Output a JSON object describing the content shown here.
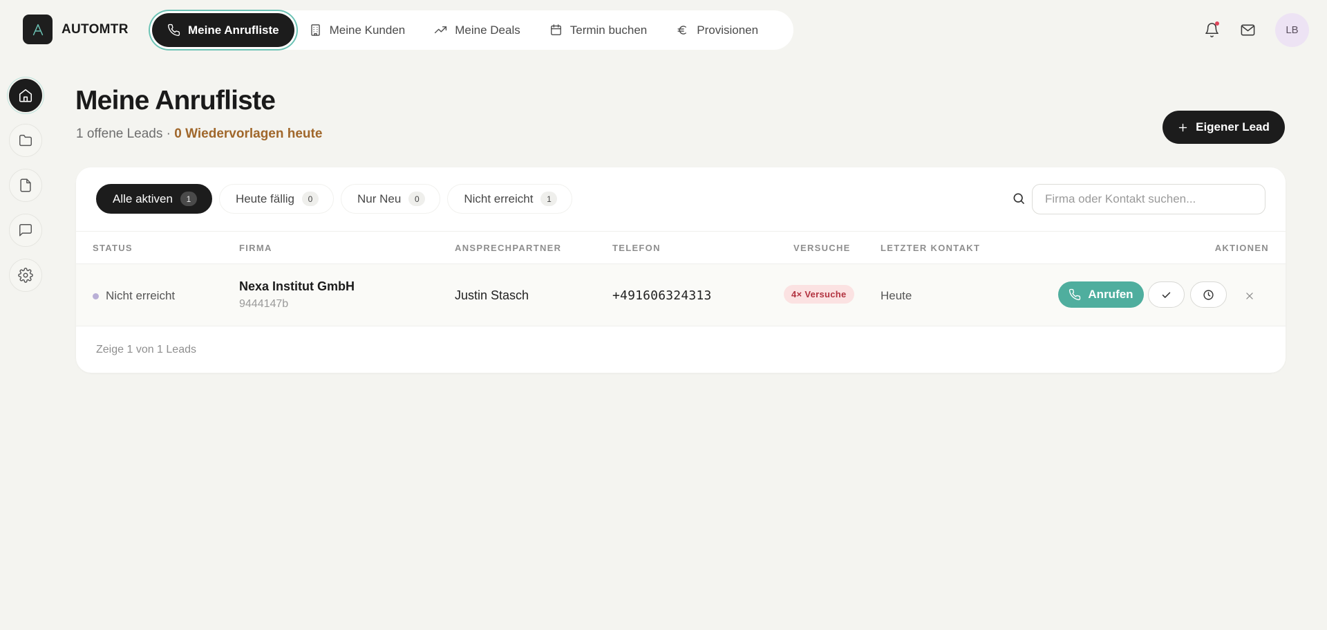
{
  "brand": {
    "name": "AUTOMTR",
    "logo_icon": "automtr-logo"
  },
  "topnav": {
    "items": [
      {
        "label": "Meine Anrufliste",
        "icon": "phone-icon",
        "active": true
      },
      {
        "label": "Meine Kunden",
        "icon": "building-icon",
        "active": false
      },
      {
        "label": "Meine Deals",
        "icon": "trending-up-icon",
        "active": false
      },
      {
        "label": "Termin buchen",
        "icon": "calendar-icon",
        "active": false
      },
      {
        "label": "Provisionen",
        "icon": "euro-icon",
        "active": false
      }
    ]
  },
  "topbar": {
    "notification_icon": "bell-icon",
    "notification_dot_color": "#e0455a",
    "mail_icon": "mail-icon",
    "avatar_initials": "LB"
  },
  "sidebar": {
    "items": [
      {
        "icon": "home-icon",
        "active": true
      },
      {
        "icon": "folder-icon",
        "active": false
      },
      {
        "icon": "document-icon",
        "active": false
      },
      {
        "icon": "chat-icon",
        "active": false
      },
      {
        "icon": "settings-icon",
        "active": false
      }
    ]
  },
  "header": {
    "title": "Meine Anrufliste",
    "subtitle_prefix": "1 offene Leads · ",
    "subtitle_highlight": "0 Wiedervorlagen heute",
    "action_label": "Eigener Lead"
  },
  "filters": [
    {
      "label": "Alle aktiven",
      "count": "1",
      "active": true
    },
    {
      "label": "Heute fällig",
      "count": "0",
      "active": false
    },
    {
      "label": "Nur Neu",
      "count": "0",
      "active": false
    },
    {
      "label": "Nicht erreicht",
      "count": "1",
      "active": false
    }
  ],
  "search": {
    "placeholder": "Firma oder Kontakt suchen...",
    "value": ""
  },
  "table": {
    "columns": [
      "STATUS",
      "FIRMA",
      "ANSPRECHPARTNER",
      "TELEFON",
      "VERSUCHE",
      "LETZTER KONTAKT",
      "AKTIONEN"
    ],
    "rows": [
      {
        "status": "Nicht erreicht",
        "company": "Nexa Institut GmbH",
        "company_id": "9444147b",
        "contact": "Justin Stasch",
        "phone": "+491606324313",
        "attempts": "4× Versuche",
        "last_contact": "Heute",
        "call_label": "Anrufen"
      }
    ],
    "footer": "Zeige 1 von 1 Leads"
  },
  "colors": {
    "accent_teal": "#4fae9e",
    "highlight_brown": "#a0672b",
    "status_dot": "#b9afd6",
    "attempts_bg": "#fbe2e2",
    "attempts_text": "#b2323f",
    "dark": "#1c1c1c"
  }
}
